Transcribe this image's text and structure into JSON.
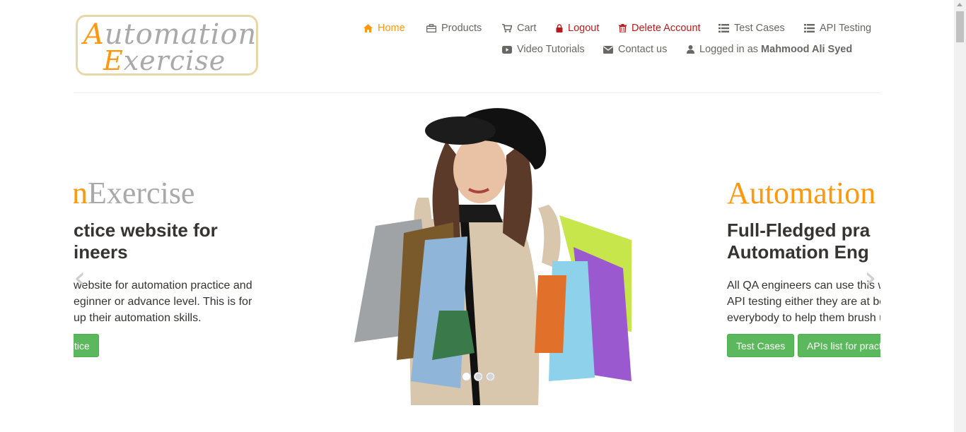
{
  "logo": {
    "line1_cap": "A",
    "line1_rest": "utomation",
    "line2_cap": "E",
    "line2_rest": "xercise"
  },
  "nav": {
    "home": "Home",
    "products": "Products",
    "cart": "Cart",
    "logout": "Logout",
    "delete_account": "Delete Account",
    "test_cases": "Test Cases",
    "api_testing": "API Testing",
    "video_tutorials": "Video Tutorials",
    "contact_us": "Contact us",
    "logged_in_prefix": "Logged in as",
    "username": "Mahmood Ali Syed"
  },
  "slider": {
    "left_slide": {
      "brand_orange": "n",
      "brand_gray": "Exercise",
      "headline_line1": "ctice website for",
      "headline_line2": "ineers",
      "para_line1": "website for automation practice and",
      "para_line2": "eginner or advance level. This is for",
      "para_line3": "up their automation skills.",
      "button": "tice"
    },
    "right_slide": {
      "brand_orange": "Automation",
      "headline_line1": "Full-Fledged pra",
      "headline_line2": "Automation Eng",
      "para_line1": "All QA engineers can use this w",
      "para_line2": "API testing either they are at be",
      "para_line3": "everybody to help them brush u",
      "button_test_cases": "Test Cases",
      "button_apis": "APIs list for practi"
    },
    "prev_arrow": "‹",
    "next_arrow": "›",
    "active_dot": 1
  },
  "colors": {
    "accent": "#fe980f",
    "danger": "#b71c1c",
    "button": "#5cb85c"
  }
}
